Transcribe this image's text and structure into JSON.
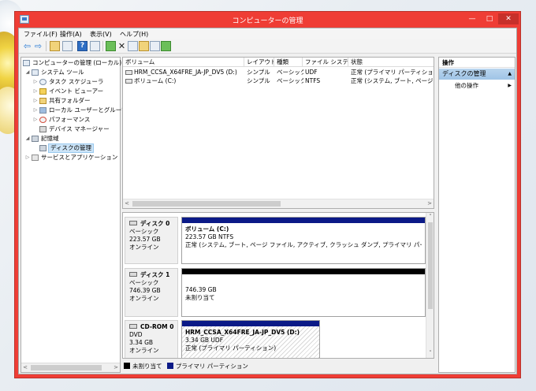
{
  "window": {
    "title": "コンピューターの管理",
    "minimize_glyph": "—",
    "maximize_glyph": "□",
    "close_glyph": "✕"
  },
  "menu": [
    "ファイル(F)",
    "操作(A)",
    "表示(V)",
    "ヘルプ(H)"
  ],
  "toolbar": {
    "back_glyph": "⇦",
    "forward_glyph": "⇨",
    "help_glyph": "?",
    "delete_glyph": "✕"
  },
  "tree": {
    "items": [
      {
        "label": "コンピューターの管理 (ローカル)",
        "expander": ""
      },
      {
        "label": "システム ツール",
        "expander": "◢"
      },
      {
        "label": "タスク スケジューラ",
        "expander": "▷"
      },
      {
        "label": "イベント ビューアー",
        "expander": "▷"
      },
      {
        "label": "共有フォルダー",
        "expander": "▷"
      },
      {
        "label": "ローカル ユーザーとグループ",
        "expander": "▷"
      },
      {
        "label": "パフォーマンス",
        "expander": "▷"
      },
      {
        "label": "デバイス マネージャー",
        "expander": ""
      },
      {
        "label": "記憶域",
        "expander": "◢"
      },
      {
        "label": "ディスクの管理",
        "expander": ""
      },
      {
        "label": "サービスとアプリケーション",
        "expander": "▷"
      }
    ],
    "scroll_left": "<",
    "scroll_right": ">"
  },
  "volumes": {
    "columns": [
      "ボリューム",
      "レイアウト",
      "種類",
      "ファイル システム",
      "状態"
    ],
    "rows": [
      {
        "volume": "HRM_CCSA_X64FRE_JA-JP_DV5 (D:)",
        "layout": "シンプル",
        "type": "ベーシック",
        "fs": "UDF",
        "status": "正常 (プライマリ パーティション)"
      },
      {
        "volume": "ボリューム (C:)",
        "layout": "シンプル",
        "type": "ベーシック",
        "fs": "NTFS",
        "status": "正常 (システム, ブート, ページ"
      }
    ],
    "scroll_left": "<",
    "scroll_right": ">"
  },
  "disks": [
    {
      "name": "ディスク 0",
      "kind": "ベーシック",
      "size": "223.57 GB",
      "state": "オンライン",
      "partition": {
        "title": "ボリューム (C:)",
        "line1": "223.57 GB NTFS",
        "line2": "正常 (システム, ブート, ページ ファイル, アクティブ, クラッシュ ダンプ, プライマリ パーティ",
        "bar_color": "#0b1a87"
      }
    },
    {
      "name": "ディスク 1",
      "kind": "ベーシック",
      "size": "746.39 GB",
      "state": "オンライン",
      "partition": {
        "title": "",
        "line1": "746.39 GB",
        "line2": "未割り当て",
        "bar_color": "#000000"
      }
    },
    {
      "name": "CD-ROM 0",
      "kind": "DVD",
      "size": "3.34 GB",
      "state": "オンライン",
      "partition": {
        "title": "HRM_CCSA_X64FRE_JA-JP_DV5 (D:)",
        "line1": "3.34 GB UDF",
        "line2": "正常 (プライマリ パーティション)",
        "bar_color": "#0b1a87"
      }
    }
  ],
  "disk_scroll": {
    "up": "˄",
    "down": "˅"
  },
  "legend": [
    {
      "label": "未割り当て",
      "color": "#000000"
    },
    {
      "label": "プライマリ パーティション",
      "color": "#0b1a87"
    }
  ],
  "actions": {
    "header": "操作",
    "section": "ディスクの管理",
    "section_glyph": "▲",
    "item": "他の操作",
    "item_glyph": "▶"
  }
}
